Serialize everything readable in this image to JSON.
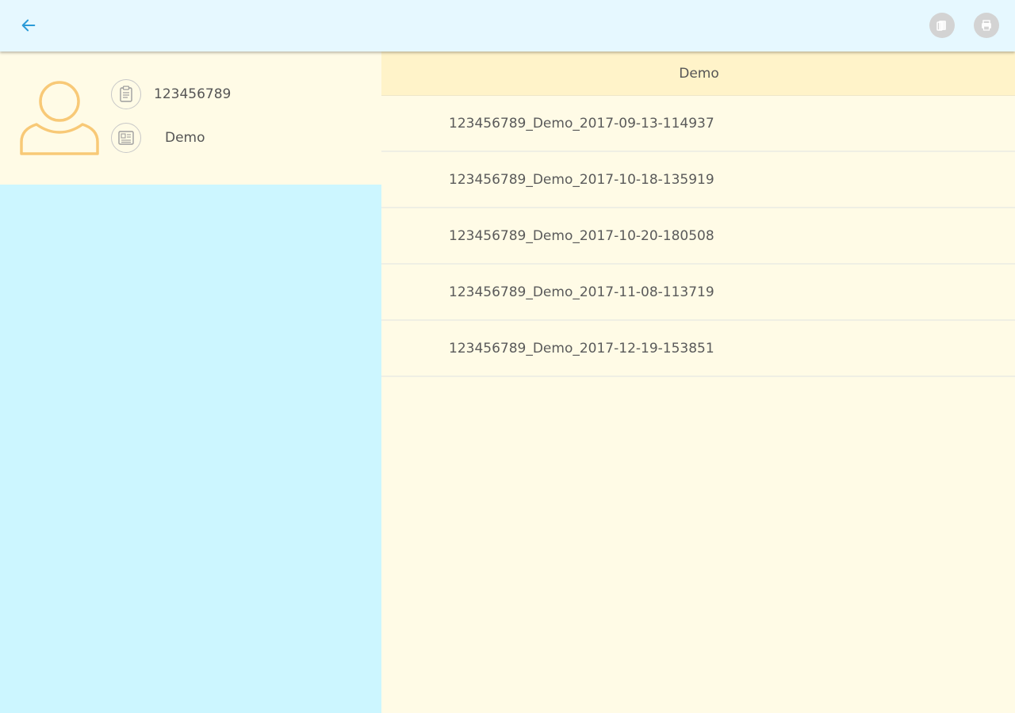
{
  "topbar": {
    "back_icon": "arrow-left-icon",
    "accent_color": "#2a9bd8",
    "action_icons": [
      "copy-document-icon",
      "print-icon"
    ]
  },
  "profile": {
    "avatar_icon": "user-avatar-icon",
    "avatar_color": "#f8c977",
    "id_icon": "clipboard-icon",
    "id_value": "123456789",
    "name_icon": "id-card-icon",
    "name_value": "Demo"
  },
  "list": {
    "header": "Demo",
    "items": [
      "123456789_Demo_2017-09-13-114937",
      "123456789_Demo_2017-10-18-135919",
      "123456789_Demo_2017-10-20-180508",
      "123456789_Demo_2017-11-08-113719",
      "123456789_Demo_2017-12-19-153851"
    ]
  }
}
